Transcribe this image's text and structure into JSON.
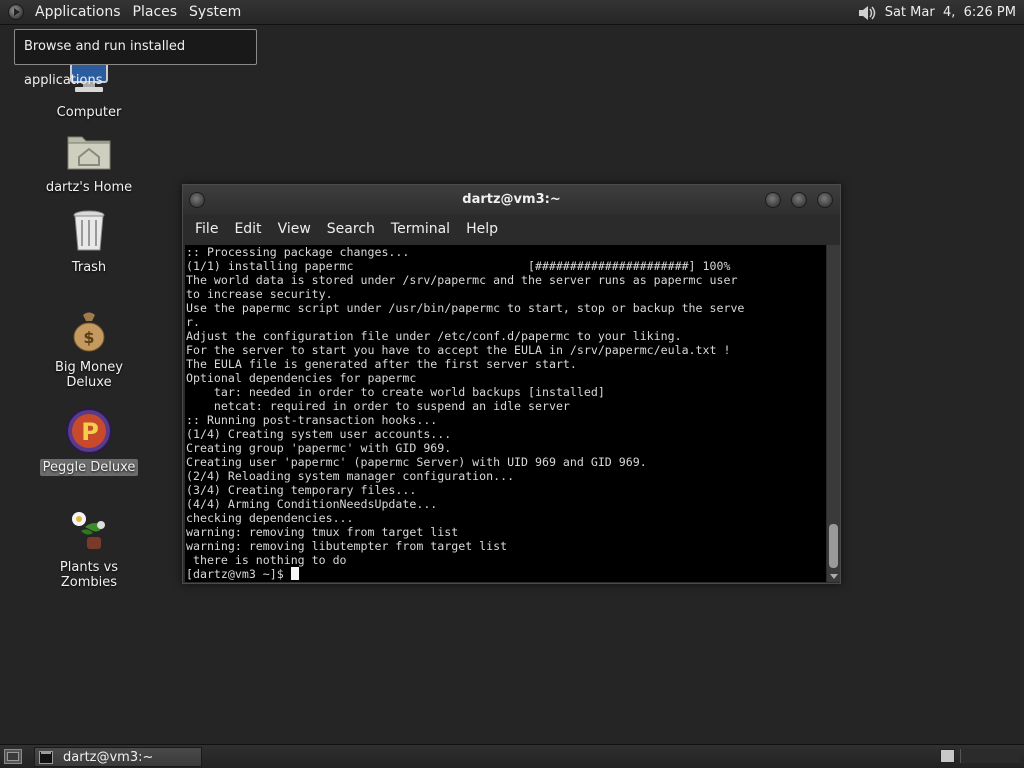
{
  "top_panel": {
    "menus": [
      "Applications",
      "Places",
      "System"
    ],
    "clock": "Sat Mar  4,  6:26 PM",
    "volume_icon": "speaker-icon"
  },
  "tooltip": "Browse and run installed applications",
  "desktop_icons": [
    {
      "label": "Computer",
      "icon": "computer-icon"
    },
    {
      "label": "dartz's Home",
      "icon": "home-folder-icon"
    },
    {
      "label": "Trash",
      "icon": "trash-icon"
    },
    {
      "label": "Big Money Deluxe",
      "icon": "money-bag-icon"
    },
    {
      "label": "Peggle Deluxe",
      "icon": "peggle-icon",
      "selected": true
    },
    {
      "label": "Plants vs Zombies",
      "icon": "plants-icon"
    }
  ],
  "terminal": {
    "title": "dartz@vm3:~",
    "menus": [
      "File",
      "Edit",
      "View",
      "Search",
      "Terminal",
      "Help"
    ],
    "lines": [
      ":: Processing package changes...",
      "(1/1) installing papermc                         [######################] 100%",
      "The world data is stored under /srv/papermc and the server runs as papermc user",
      "to increase security.",
      "Use the papermc script under /usr/bin/papermc to start, stop or backup the serve",
      "r.",
      "Adjust the configuration file under /etc/conf.d/papermc to your liking.",
      "For the server to start you have to accept the EULA in /srv/papermc/eula.txt !",
      "The EULA file is generated after the first server start.",
      "Optional dependencies for papermc",
      "    tar: needed in order to create world backups [installed]",
      "    netcat: required in order to suspend an idle server",
      ":: Running post-transaction hooks...",
      "(1/4) Creating system user accounts...",
      "Creating group 'papermc' with GID 969.",
      "Creating user 'papermc' (papermc Server) with UID 969 and GID 969.",
      "(2/4) Reloading system manager configuration...",
      "(3/4) Creating temporary files...",
      "(4/4) Arming ConditionNeedsUpdate...",
      "checking dependencies...",
      "warning: removing tmux from target list",
      "warning: removing libutempter from target list",
      " there is nothing to do"
    ],
    "prompt": "[dartz@vm3 ~]$ "
  },
  "taskbar": {
    "window_button": "dartz@vm3:~"
  }
}
